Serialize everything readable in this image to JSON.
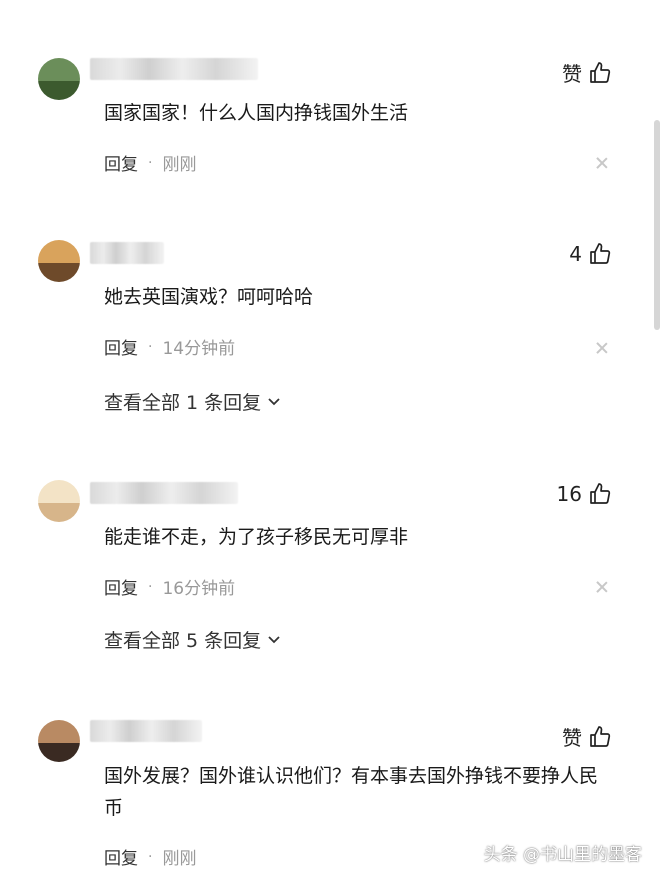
{
  "comments": [
    {
      "like_label": "赞",
      "text": "国家国家！什么人国内挣钱国外生活",
      "reply_label": "回复",
      "time": "刚刚",
      "view_all": ""
    },
    {
      "like_label": "4",
      "text": "她去英国演戏？呵呵哈哈",
      "reply_label": "回复",
      "time": "14分钟前",
      "view_all": "查看全部 1 条回复"
    },
    {
      "like_label": "16",
      "text": "能走谁不走，为了孩子移民无可厚非",
      "reply_label": "回复",
      "time": "16分钟前",
      "view_all": "查看全部 5 条回复"
    },
    {
      "like_label": "赞",
      "text": "国外发展？国外谁认识他们？有本事去国外挣钱不要挣人民币",
      "reply_label": "回复",
      "time": "刚刚",
      "view_all": ""
    }
  ],
  "icons": {
    "like": "thumbs-up-icon",
    "close": "close-icon",
    "expand": "chevron-down-icon"
  },
  "watermark": "头条 @书山里的墨客"
}
